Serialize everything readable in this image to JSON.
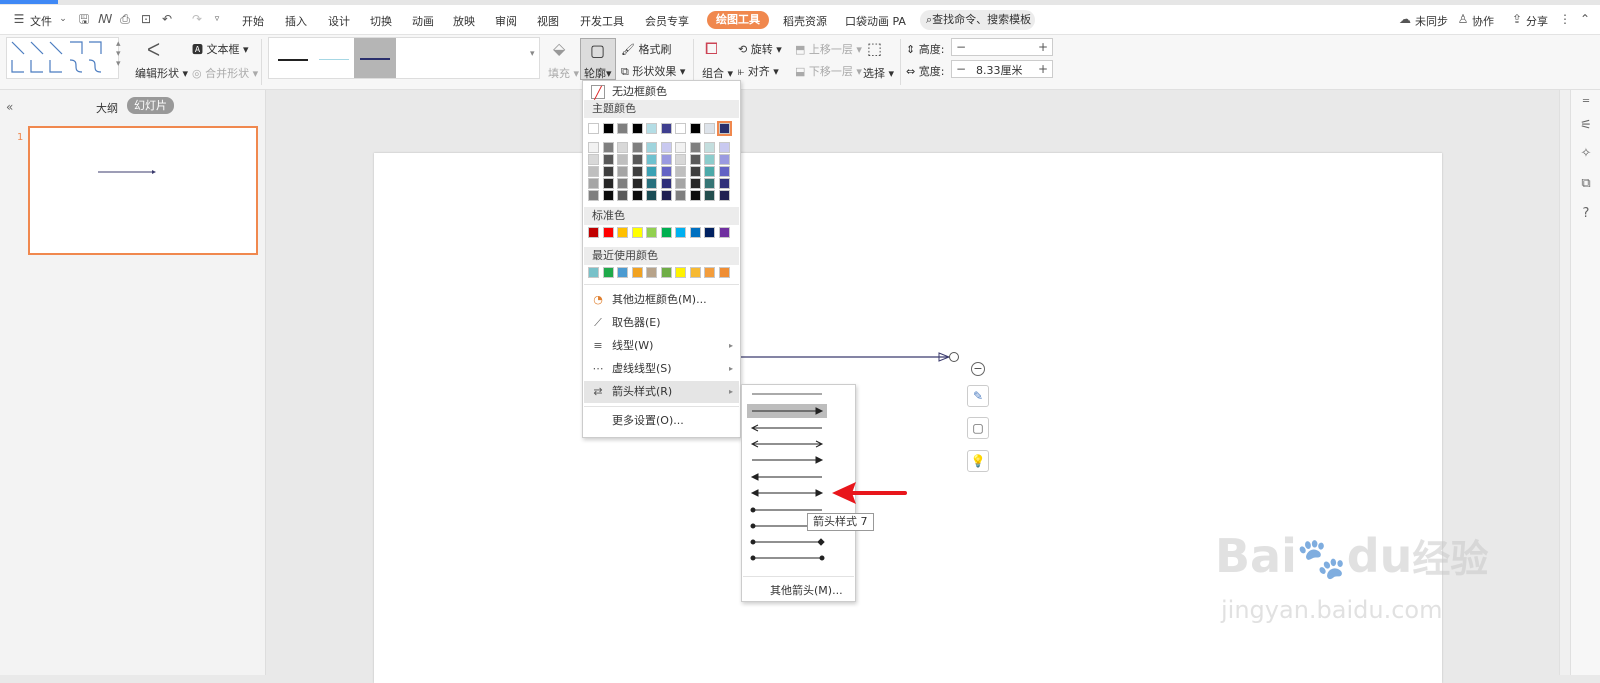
{
  "menubar": {
    "file_label": "文件",
    "tabs": [
      "开始",
      "插入",
      "设计",
      "切换",
      "动画",
      "放映",
      "审阅",
      "视图",
      "开发工具",
      "会员专享"
    ],
    "active_tab": "绘图工具",
    "tabs_after": [
      "稻壳资源",
      "口袋动画 PA"
    ],
    "search_placeholder": "查找命令、搜索模板",
    "right": {
      "sync": "未同步",
      "collab": "协作",
      "share": "分享"
    }
  },
  "ribbon": {
    "edit_shape": "编辑形状",
    "textbox": "文本框",
    "merge_shape": "合并形状",
    "fill": "填充",
    "outline": "轮廓",
    "format_painter": "格式刷",
    "shape_effect": "形状效果",
    "rotate": "旋转",
    "bring_forward": "上移一层",
    "send_backward": "下移一层",
    "group": "组合",
    "align": "对齐",
    "select": "选择",
    "height_label": "高度:",
    "height_value": "",
    "width_label": "宽度:",
    "width_value": "8.33厘米"
  },
  "leftpanel": {
    "outline_tab": "大纲",
    "slides_tab": "幻灯片",
    "slide_number": "1"
  },
  "dropdown": {
    "no_border": "无边框颜色",
    "theme_colors_header": "主题颜色",
    "standard_colors_header": "标准色",
    "recent_colors_header": "最近使用颜色",
    "more_colors": "其他边框颜色(M)...",
    "eyedropper": "取色器(E)",
    "line_type": "线型(W)",
    "dash_type": "虚线线型(S)",
    "arrow_style": "箭头样式(R)",
    "more_settings": "更多设置(O)...",
    "theme_top_row": [
      "#ffffff",
      "#000000",
      "#7f7f7f",
      "#000000",
      "#b4dde5",
      "#3f3f8f",
      "#ffffff",
      "#000000",
      "#dde3ea",
      "#2a2f6c"
    ],
    "theme_shades": [
      [
        "#f2f2f2",
        "#7f7f7f",
        "#d8d8d8",
        "#7f7f7f",
        "#9fd4dd",
        "#c9c9f0",
        "#f2f2f2",
        "#7f7f7f",
        "#c4dede",
        "#c9c9f0"
      ],
      [
        "#d8d8d8",
        "#595959",
        "#bfbfbf",
        "#595959",
        "#6fc1cf",
        "#9a9ae0",
        "#d8d8d8",
        "#595959",
        "#8ccccc",
        "#9a9ae0"
      ],
      [
        "#bfbfbf",
        "#3f3f3f",
        "#a5a5a5",
        "#3f3f3f",
        "#3aa1b4",
        "#6363c4",
        "#bfbfbf",
        "#3f3f3f",
        "#4ca9a9",
        "#6363c4"
      ],
      [
        "#a5a5a5",
        "#262626",
        "#7f7f7f",
        "#262626",
        "#28717e",
        "#2f2f7a",
        "#a5a5a5",
        "#262626",
        "#357575",
        "#2f2f7a"
      ],
      [
        "#7f7f7f",
        "#0c0c0c",
        "#595959",
        "#0c0c0c",
        "#1a4b54",
        "#1f1f51",
        "#7f7f7f",
        "#0c0c0c",
        "#234e4e",
        "#1f1f51"
      ]
    ],
    "standard_colors": [
      "#c00000",
      "#ff0000",
      "#ffc000",
      "#ffff00",
      "#92d050",
      "#00b050",
      "#00b0f0",
      "#0070c0",
      "#002060",
      "#7030a0"
    ],
    "recent_colors": [
      "#78c1c9",
      "#1fa94a",
      "#4b9bd1",
      "#f1a220",
      "#b7a38a",
      "#6fad47",
      "#fff200",
      "#f6b932",
      "#f39d3c",
      "#ef8d33"
    ]
  },
  "arrow_menu": {
    "selected_index": 1,
    "tooltip": "箭头样式 7",
    "more_arrows": "其他箭头(M)..."
  },
  "colors": {
    "accent_orange": "#f0884e",
    "line_navy": "#3b3b6e",
    "annotation_red": "#e8161b"
  },
  "watermark": {
    "brand": "Bai",
    "brand_suffix": "du",
    "product": "经验",
    "url": "jingyan.baidu.com"
  }
}
